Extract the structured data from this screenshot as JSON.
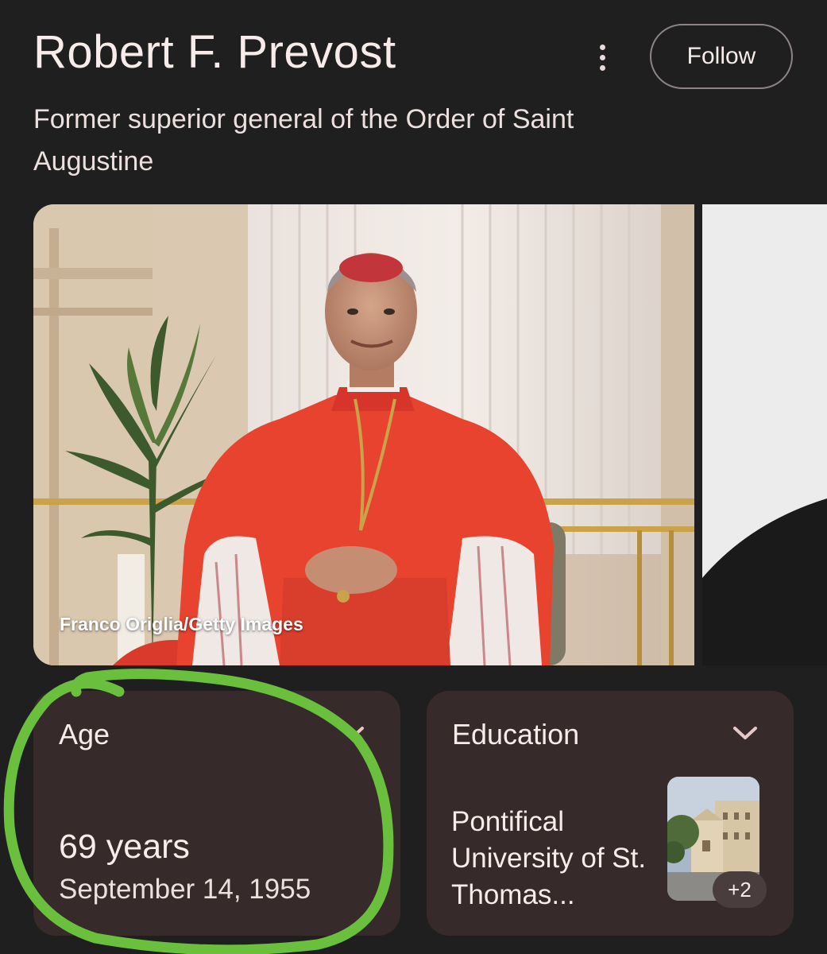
{
  "header": {
    "title": "Robert F. Prevost",
    "follow_label": "Follow",
    "subtitle": "Former superior general of the Order of Saint Augustine"
  },
  "photos": {
    "main_caption": "Franco Origlia/Getty Images"
  },
  "cards": {
    "age": {
      "label": "Age",
      "value": "69 years",
      "date": "September 14, 1955"
    },
    "education": {
      "label": "Education",
      "value": "Pontifical University of St. Thomas...",
      "thumbnail_badge": "+2"
    }
  },
  "colors": {
    "background": "#1f1f1f",
    "card": "#362a2b",
    "annotation": "#6abf3c"
  },
  "icons": {
    "more": "more-vert-icon",
    "expand": "chevron-down-icon"
  }
}
